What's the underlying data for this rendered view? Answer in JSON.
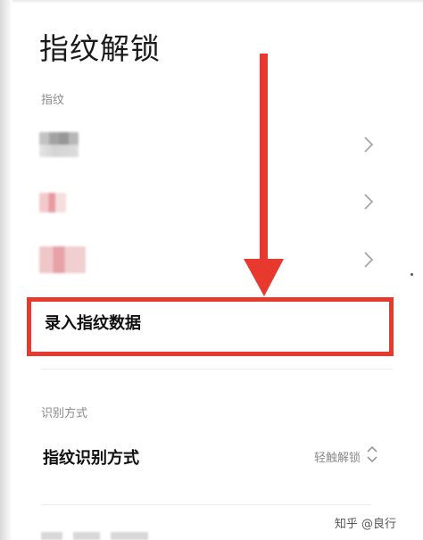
{
  "page": {
    "title": "指纹解锁"
  },
  "fingerprint_section": {
    "label": "指纹",
    "items": [
      {
        "name": "",
        "chevron_icon": "chevron-right-icon"
      },
      {
        "name": "",
        "chevron_icon": "chevron-right-icon"
      },
      {
        "name": "",
        "chevron_icon": "chevron-right-icon"
      }
    ],
    "enroll_label": "录入指纹数据"
  },
  "recognition_section": {
    "label": "识别方式",
    "mode_label": "指纹识别方式",
    "mode_value": "轻触解锁",
    "mode_icon": "up-down-chevron-icon"
  },
  "annotation": {
    "arrow_color": "#e8392f",
    "highlight_color": "#e8392f"
  },
  "watermark": {
    "text": "知乎 @良行"
  }
}
